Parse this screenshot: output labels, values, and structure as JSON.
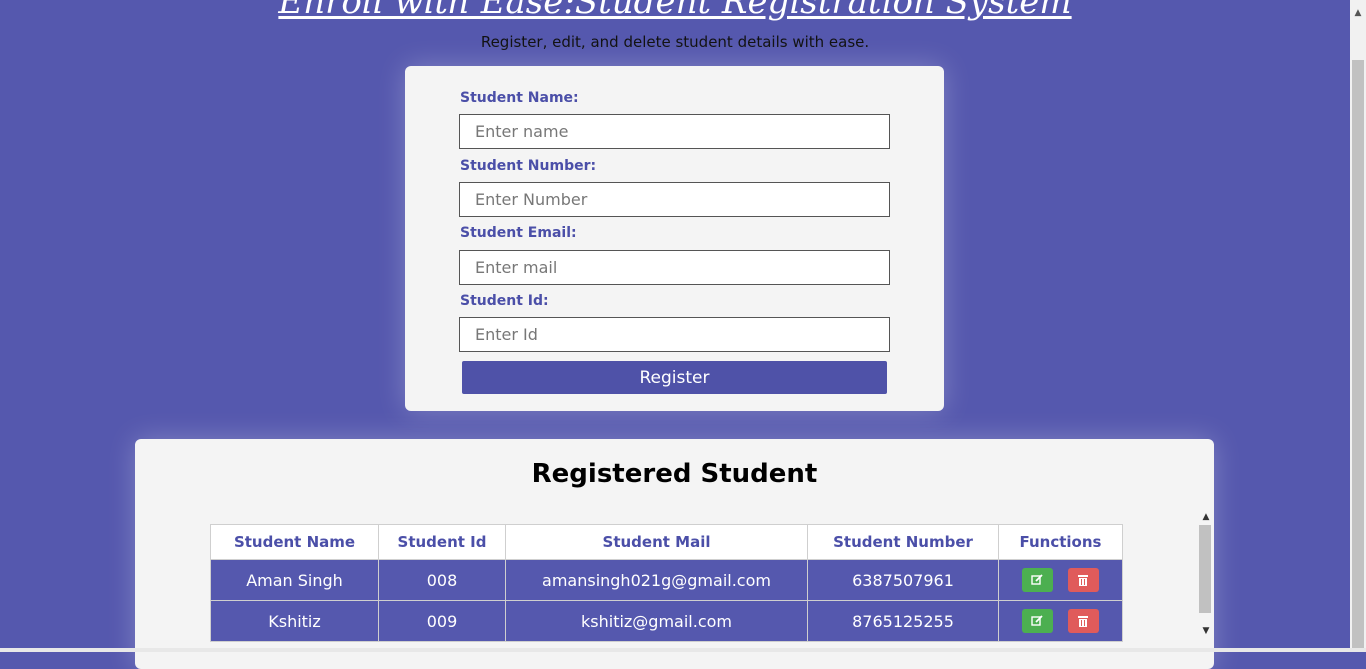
{
  "header": {
    "title": "Enroll with Ease:Student Registration System",
    "subtitle": "Register, edit, and delete student details with ease."
  },
  "form": {
    "name_label": "Student Name:",
    "name_placeholder": "Enter name",
    "number_label": "Student Number:",
    "number_placeholder": "Enter Number",
    "email_label": "Student Email:",
    "email_placeholder": "Enter mail",
    "id_label": "Student Id:",
    "id_placeholder": "Enter Id",
    "register_label": "Register"
  },
  "table": {
    "title": "Registered Student",
    "columns": [
      "Student Name",
      "Student Id",
      "Student Mail",
      "Student Number",
      "Functions"
    ],
    "rows": [
      {
        "name": "Aman Singh",
        "id": "008",
        "mail": "amansingh021g@gmail.com",
        "number": "6387507961"
      },
      {
        "name": "Kshitiz",
        "id": "009",
        "mail": "kshitiz@gmail.com",
        "number": "8765125255"
      }
    ]
  },
  "icons": {
    "edit": "edit-icon",
    "delete": "trash-icon"
  },
  "colors": {
    "background": "#5558ae",
    "card": "#f4f4f4",
    "accent": "#4f52a8",
    "edit": "#4caf50",
    "delete": "#e05b5b"
  }
}
